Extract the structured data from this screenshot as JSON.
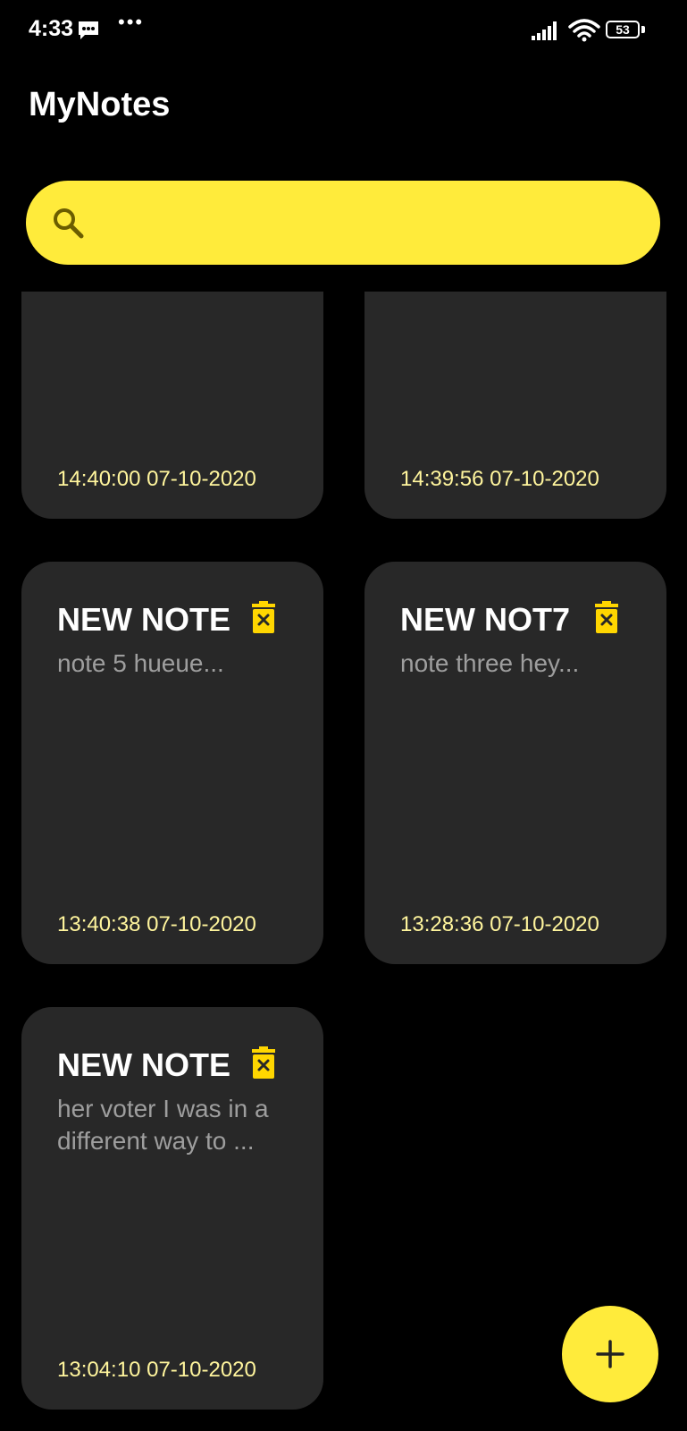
{
  "status_bar": {
    "time": "4:33",
    "battery": "53",
    "icons": [
      "message-icon",
      "more-dots-icon",
      "signal-icon",
      "wifi-icon",
      "battery-icon"
    ],
    "more": "•••"
  },
  "app": {
    "title": "MyNotes"
  },
  "search": {
    "placeholder": "",
    "value": "",
    "icon": "search-icon"
  },
  "notes": [
    {
      "title": "",
      "body": "",
      "time": "14:40:00 07-10-2020"
    },
    {
      "title": "",
      "body": "",
      "time": "14:39:56 07-10-2020"
    },
    {
      "title": "NEW NOTE",
      "body": "note 5 hueue...",
      "time": "13:40:38 07-10-2020"
    },
    {
      "title": "NEW NOT7",
      "body": "note three hey...",
      "time": "13:28:36 07-10-2020"
    },
    {
      "title": "NEW NOTE",
      "body": "her voter I was in a different way to ...",
      "time": "13:04:10 07-10-2020"
    }
  ],
  "fab": {
    "icon": "plus-icon"
  },
  "colors": {
    "background": "#000000",
    "accent": "#ffeb3b",
    "card": "#282828",
    "timestamp": "#fff59d",
    "delete_icon": "#ffd600"
  }
}
